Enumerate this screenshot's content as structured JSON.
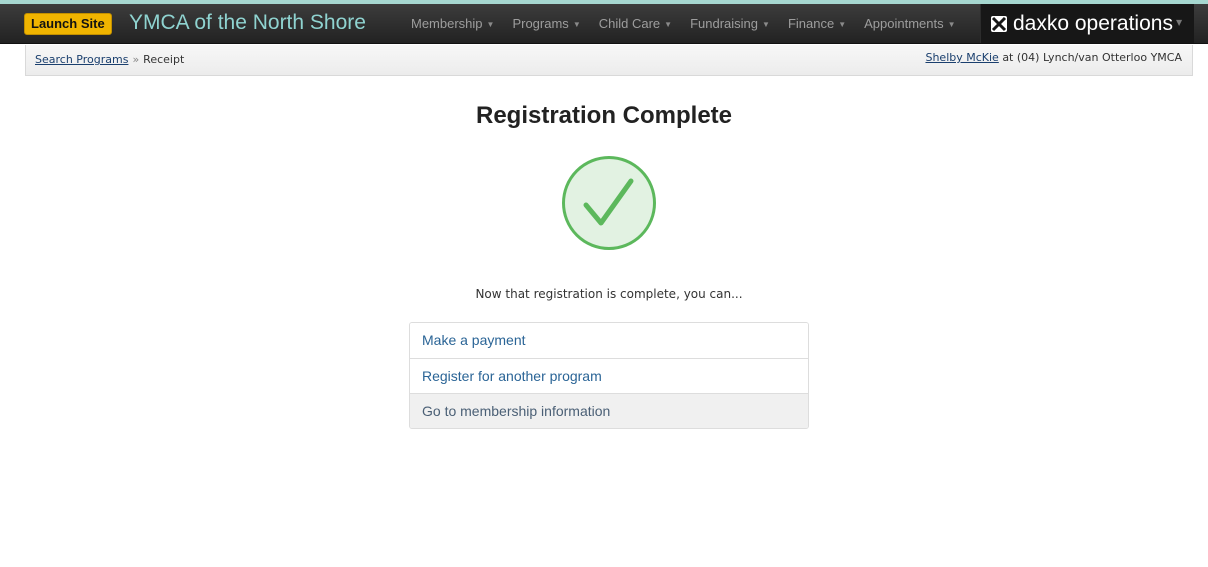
{
  "colors": {
    "accent_strip": "#a6d7d0",
    "navbar": "#2b2b2b",
    "launch_badge": "#f0b400",
    "brand_text": "#8fd3d0",
    "success": "#5cb85c",
    "success_fill": "#e2f2e2",
    "link": "#2a6496"
  },
  "header": {
    "launch_label": "Launch Site",
    "brand": "YMCA of the North Shore",
    "nav": [
      {
        "label": "Membership",
        "icon": "caret-down-icon"
      },
      {
        "label": "Programs",
        "icon": "caret-down-icon"
      },
      {
        "label": "Child Care",
        "icon": "caret-down-icon"
      },
      {
        "label": "Fundraising",
        "icon": "caret-down-icon"
      },
      {
        "label": "Finance",
        "icon": "caret-down-icon"
      },
      {
        "label": "Appointments",
        "icon": "caret-down-icon"
      }
    ],
    "product": {
      "icon": "daxko-logo-icon",
      "label": "daxko operations"
    }
  },
  "breadcrumb": {
    "items": [
      {
        "label": "Search Programs",
        "link": true
      },
      {
        "label": "Receipt",
        "link": false
      }
    ],
    "separator": "»"
  },
  "user": {
    "name": "Shelby McKie",
    "location": "at (04) Lynch/van Otterloo YMCA"
  },
  "main": {
    "title": "Registration Complete",
    "status_icon": "success-check-icon",
    "subtext": "Now that registration is complete, you can...",
    "options": [
      {
        "label": "Make a payment"
      },
      {
        "label": "Register for another program"
      },
      {
        "label": "Go to membership information"
      }
    ]
  }
}
